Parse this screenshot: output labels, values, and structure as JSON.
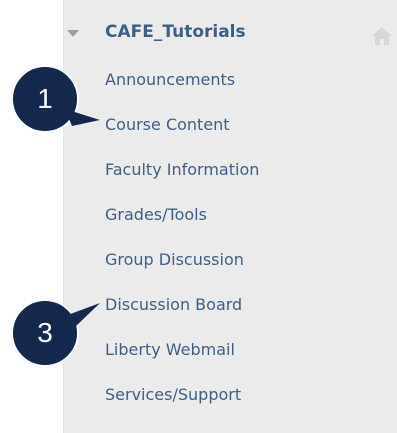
{
  "course": {
    "title": "CAFE_Tutorials"
  },
  "menu": {
    "items": [
      {
        "label": "Announcements"
      },
      {
        "label": "Course Content"
      },
      {
        "label": "Faculty Information"
      },
      {
        "label": "Grades/Tools"
      },
      {
        "label": "Group Discussion"
      },
      {
        "label": "Discussion Board"
      },
      {
        "label": "Liberty Webmail"
      },
      {
        "label": "Services/Support"
      }
    ]
  },
  "callouts": [
    {
      "number": "1"
    },
    {
      "number": "3"
    }
  ],
  "colors": {
    "link": "#3d5f84",
    "panel_background": "#ebebeb",
    "callout_fill": "#14284d"
  },
  "icons": {
    "collapse": "triangle-down-icon",
    "home": "home-icon"
  }
}
